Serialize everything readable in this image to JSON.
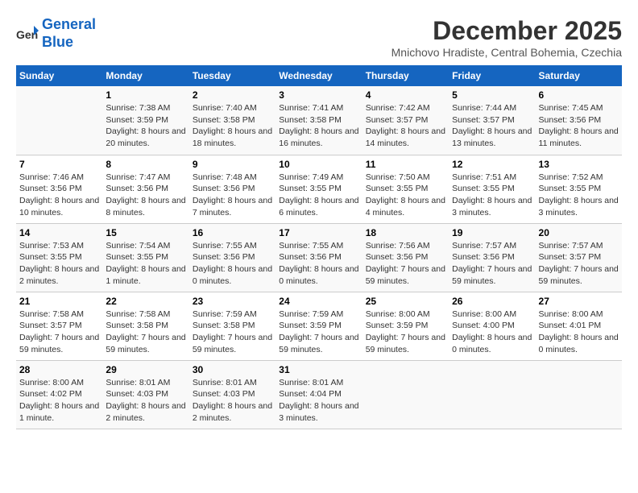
{
  "logo": {
    "line1": "General",
    "line2": "Blue"
  },
  "title": "December 2025",
  "location": "Mnichovo Hradiste, Central Bohemia, Czechia",
  "days_of_week": [
    "Sunday",
    "Monday",
    "Tuesday",
    "Wednesday",
    "Thursday",
    "Friday",
    "Saturday"
  ],
  "weeks": [
    [
      {
        "day": "",
        "sunrise": "",
        "sunset": "",
        "daylight": ""
      },
      {
        "day": "1",
        "sunrise": "Sunrise: 7:38 AM",
        "sunset": "Sunset: 3:59 PM",
        "daylight": "Daylight: 8 hours and 20 minutes."
      },
      {
        "day": "2",
        "sunrise": "Sunrise: 7:40 AM",
        "sunset": "Sunset: 3:58 PM",
        "daylight": "Daylight: 8 hours and 18 minutes."
      },
      {
        "day": "3",
        "sunrise": "Sunrise: 7:41 AM",
        "sunset": "Sunset: 3:58 PM",
        "daylight": "Daylight: 8 hours and 16 minutes."
      },
      {
        "day": "4",
        "sunrise": "Sunrise: 7:42 AM",
        "sunset": "Sunset: 3:57 PM",
        "daylight": "Daylight: 8 hours and 14 minutes."
      },
      {
        "day": "5",
        "sunrise": "Sunrise: 7:44 AM",
        "sunset": "Sunset: 3:57 PM",
        "daylight": "Daylight: 8 hours and 13 minutes."
      },
      {
        "day": "6",
        "sunrise": "Sunrise: 7:45 AM",
        "sunset": "Sunset: 3:56 PM",
        "daylight": "Daylight: 8 hours and 11 minutes."
      }
    ],
    [
      {
        "day": "7",
        "sunrise": "Sunrise: 7:46 AM",
        "sunset": "Sunset: 3:56 PM",
        "daylight": "Daylight: 8 hours and 10 minutes."
      },
      {
        "day": "8",
        "sunrise": "Sunrise: 7:47 AM",
        "sunset": "Sunset: 3:56 PM",
        "daylight": "Daylight: 8 hours and 8 minutes."
      },
      {
        "day": "9",
        "sunrise": "Sunrise: 7:48 AM",
        "sunset": "Sunset: 3:56 PM",
        "daylight": "Daylight: 8 hours and 7 minutes."
      },
      {
        "day": "10",
        "sunrise": "Sunrise: 7:49 AM",
        "sunset": "Sunset: 3:55 PM",
        "daylight": "Daylight: 8 hours and 6 minutes."
      },
      {
        "day": "11",
        "sunrise": "Sunrise: 7:50 AM",
        "sunset": "Sunset: 3:55 PM",
        "daylight": "Daylight: 8 hours and 4 minutes."
      },
      {
        "day": "12",
        "sunrise": "Sunrise: 7:51 AM",
        "sunset": "Sunset: 3:55 PM",
        "daylight": "Daylight: 8 hours and 3 minutes."
      },
      {
        "day": "13",
        "sunrise": "Sunrise: 7:52 AM",
        "sunset": "Sunset: 3:55 PM",
        "daylight": "Daylight: 8 hours and 3 minutes."
      }
    ],
    [
      {
        "day": "14",
        "sunrise": "Sunrise: 7:53 AM",
        "sunset": "Sunset: 3:55 PM",
        "daylight": "Daylight: 8 hours and 2 minutes."
      },
      {
        "day": "15",
        "sunrise": "Sunrise: 7:54 AM",
        "sunset": "Sunset: 3:55 PM",
        "daylight": "Daylight: 8 hours and 1 minute."
      },
      {
        "day": "16",
        "sunrise": "Sunrise: 7:55 AM",
        "sunset": "Sunset: 3:56 PM",
        "daylight": "Daylight: 8 hours and 0 minutes."
      },
      {
        "day": "17",
        "sunrise": "Sunrise: 7:55 AM",
        "sunset": "Sunset: 3:56 PM",
        "daylight": "Daylight: 8 hours and 0 minutes."
      },
      {
        "day": "18",
        "sunrise": "Sunrise: 7:56 AM",
        "sunset": "Sunset: 3:56 PM",
        "daylight": "Daylight: 7 hours and 59 minutes."
      },
      {
        "day": "19",
        "sunrise": "Sunrise: 7:57 AM",
        "sunset": "Sunset: 3:56 PM",
        "daylight": "Daylight: 7 hours and 59 minutes."
      },
      {
        "day": "20",
        "sunrise": "Sunrise: 7:57 AM",
        "sunset": "Sunset: 3:57 PM",
        "daylight": "Daylight: 7 hours and 59 minutes."
      }
    ],
    [
      {
        "day": "21",
        "sunrise": "Sunrise: 7:58 AM",
        "sunset": "Sunset: 3:57 PM",
        "daylight": "Daylight: 7 hours and 59 minutes."
      },
      {
        "day": "22",
        "sunrise": "Sunrise: 7:58 AM",
        "sunset": "Sunset: 3:58 PM",
        "daylight": "Daylight: 7 hours and 59 minutes."
      },
      {
        "day": "23",
        "sunrise": "Sunrise: 7:59 AM",
        "sunset": "Sunset: 3:58 PM",
        "daylight": "Daylight: 7 hours and 59 minutes."
      },
      {
        "day": "24",
        "sunrise": "Sunrise: 7:59 AM",
        "sunset": "Sunset: 3:59 PM",
        "daylight": "Daylight: 7 hours and 59 minutes."
      },
      {
        "day": "25",
        "sunrise": "Sunrise: 8:00 AM",
        "sunset": "Sunset: 3:59 PM",
        "daylight": "Daylight: 7 hours and 59 minutes."
      },
      {
        "day": "26",
        "sunrise": "Sunrise: 8:00 AM",
        "sunset": "Sunset: 4:00 PM",
        "daylight": "Daylight: 8 hours and 0 minutes."
      },
      {
        "day": "27",
        "sunrise": "Sunrise: 8:00 AM",
        "sunset": "Sunset: 4:01 PM",
        "daylight": "Daylight: 8 hours and 0 minutes."
      }
    ],
    [
      {
        "day": "28",
        "sunrise": "Sunrise: 8:00 AM",
        "sunset": "Sunset: 4:02 PM",
        "daylight": "Daylight: 8 hours and 1 minute."
      },
      {
        "day": "29",
        "sunrise": "Sunrise: 8:01 AM",
        "sunset": "Sunset: 4:03 PM",
        "daylight": "Daylight: 8 hours and 2 minutes."
      },
      {
        "day": "30",
        "sunrise": "Sunrise: 8:01 AM",
        "sunset": "Sunset: 4:03 PM",
        "daylight": "Daylight: 8 hours and 2 minutes."
      },
      {
        "day": "31",
        "sunrise": "Sunrise: 8:01 AM",
        "sunset": "Sunset: 4:04 PM",
        "daylight": "Daylight: 8 hours and 3 minutes."
      },
      {
        "day": "",
        "sunrise": "",
        "sunset": "",
        "daylight": ""
      },
      {
        "day": "",
        "sunrise": "",
        "sunset": "",
        "daylight": ""
      },
      {
        "day": "",
        "sunrise": "",
        "sunset": "",
        "daylight": ""
      }
    ]
  ]
}
